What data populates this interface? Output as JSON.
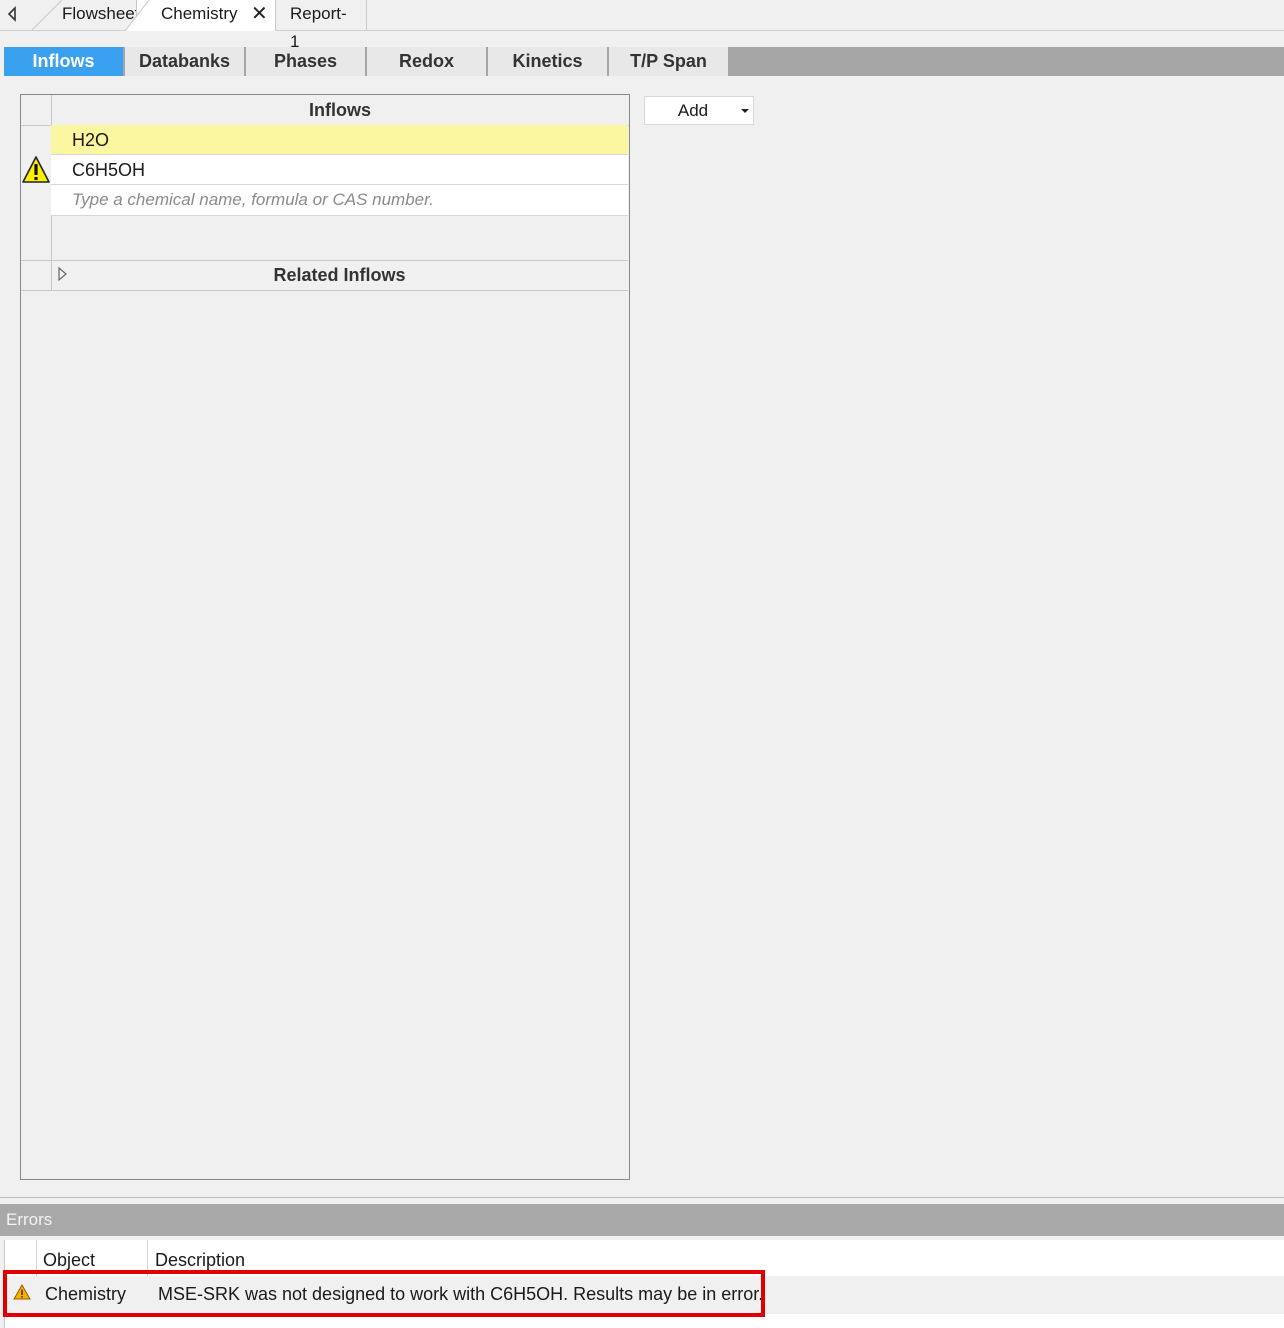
{
  "document_tabs": [
    {
      "label": "Flowsheet"
    },
    {
      "label": "Chemistry",
      "active": true,
      "closable": true
    },
    {
      "label": "Report-1"
    }
  ],
  "sub_tabs": [
    {
      "label": "Inflows",
      "active": true
    },
    {
      "label": "Databanks"
    },
    {
      "label": "Phases"
    },
    {
      "label": "Redox"
    },
    {
      "label": "Kinetics"
    },
    {
      "label": "T/P Span"
    }
  ],
  "inflows_grid": {
    "header": "Inflows",
    "rows": [
      {
        "value": "H2O",
        "selected": true,
        "warning": false
      },
      {
        "value": "C6H5OH",
        "selected": false,
        "warning": true
      }
    ],
    "new_row_placeholder": "Type a chemical name, formula or CAS number.",
    "related_label": "Related Inflows"
  },
  "add_button": {
    "label": "Add"
  },
  "errors": {
    "title": "Errors",
    "columns": {
      "object": "Object",
      "description": "Description"
    },
    "rows": [
      {
        "icon": "warning-icon",
        "object": "Chemistry",
        "description": "MSE-SRK was not designed to work with C6H5OH. Results may be in error."
      }
    ]
  },
  "colors": {
    "active_tab": "#3aa0f0",
    "selected_row": "#fbf7a1",
    "highlight_border": "#e00000",
    "warning_yellow": "#ffee00"
  }
}
